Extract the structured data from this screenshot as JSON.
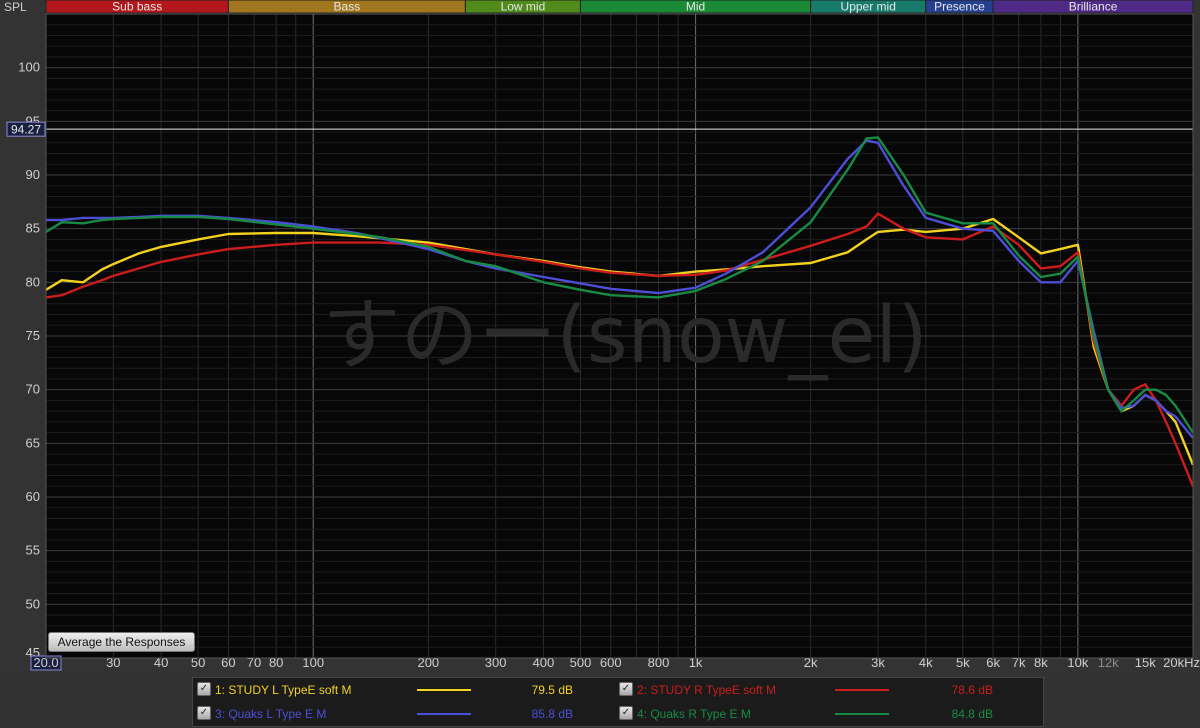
{
  "chart_data": {
    "type": "line",
    "ylabel": "SPL",
    "x_scale": "log",
    "xlim": [
      20,
      20000
    ],
    "ylim": [
      45,
      105
    ],
    "x_ticks": [
      {
        "v": 20,
        "label": "20.0",
        "box": true
      },
      {
        "v": 30,
        "label": "30"
      },
      {
        "v": 40,
        "label": "40"
      },
      {
        "v": 50,
        "label": "50"
      },
      {
        "v": 60,
        "label": "60"
      },
      {
        "v": 70,
        "label": "70"
      },
      {
        "v": 80,
        "label": "80"
      },
      {
        "v": 100,
        "label": "100"
      },
      {
        "v": 200,
        "label": "200"
      },
      {
        "v": 300,
        "label": "300"
      },
      {
        "v": 400,
        "label": "400"
      },
      {
        "v": 500,
        "label": "500"
      },
      {
        "v": 600,
        "label": "600"
      },
      {
        "v": 800,
        "label": "800"
      },
      {
        "v": 1000,
        "label": "1k"
      },
      {
        "v": 2000,
        "label": "2k"
      },
      {
        "v": 3000,
        "label": "3k"
      },
      {
        "v": 4000,
        "label": "4k"
      },
      {
        "v": 5000,
        "label": "5k"
      },
      {
        "v": 6000,
        "label": "6k"
      },
      {
        "v": 7000,
        "label": "7k"
      },
      {
        "v": 8000,
        "label": "8k"
      },
      {
        "v": 10000,
        "label": "10k"
      },
      {
        "v": 12000,
        "label": "12k",
        "dim": true
      },
      {
        "v": 15000,
        "label": "15k"
      },
      {
        "v": 20000,
        "label": "20kHz"
      }
    ],
    "y_ticks": [
      50,
      55,
      60,
      65,
      70,
      75,
      80,
      85,
      90,
      95,
      100
    ],
    "y_min_label": "45",
    "cursor": {
      "y": 94.27,
      "label": "94.27"
    },
    "bands": [
      {
        "name": "Sub bass",
        "from": 20,
        "to": 60,
        "color": "#b3161b"
      },
      {
        "name": "Bass",
        "from": 60,
        "to": 250,
        "color": "#a0771e"
      },
      {
        "name": "Low mid",
        "from": 250,
        "to": 500,
        "color": "#4f8a1a"
      },
      {
        "name": "Mid",
        "from": 500,
        "to": 2000,
        "color": "#1b8a37"
      },
      {
        "name": "Upper mid",
        "from": 2000,
        "to": 4000,
        "color": "#177a6a"
      },
      {
        "name": "Presence",
        "from": 4000,
        "to": 6000,
        "color": "#24408f"
      },
      {
        "name": "Brilliance",
        "from": 6000,
        "to": 20000,
        "color": "#4e2a86"
      }
    ],
    "watermark": "すのー(snow_el)",
    "series": [
      {
        "name": "1: STUDY L TypeE soft M",
        "color": "#f3d21f",
        "avg": "79.5 dB",
        "x": [
          20,
          22,
          25,
          28,
          30,
          35,
          40,
          50,
          60,
          80,
          100,
          130,
          150,
          200,
          250,
          300,
          400,
          500,
          600,
          800,
          1000,
          1200,
          1500,
          2000,
          2500,
          2800,
          3000,
          3500,
          4000,
          5000,
          6000,
          7000,
          8000,
          9000,
          10000,
          11000,
          12000,
          13000,
          14000,
          15000,
          16000,
          17000,
          18000,
          20000
        ],
        "y": [
          79.3,
          80.2,
          80.0,
          81.2,
          81.7,
          82.7,
          83.3,
          84.0,
          84.5,
          84.6,
          84.6,
          84.3,
          84.1,
          83.7,
          83.1,
          82.6,
          82.0,
          81.4,
          81.0,
          80.6,
          81.0,
          81.2,
          81.5,
          81.8,
          82.8,
          84.0,
          84.7,
          84.9,
          84.7,
          85.0,
          85.9,
          84.2,
          82.7,
          83.1,
          83.5,
          74.0,
          70.0,
          68.0,
          68.5,
          69.5,
          69.0,
          68.0,
          67.0,
          63.0
        ]
      },
      {
        "name": "2: STUDY R TypeE soft M",
        "color": "#cc1c1c",
        "avg": "78.6 dB",
        "x": [
          20,
          22,
          25,
          28,
          30,
          35,
          40,
          50,
          60,
          80,
          100,
          130,
          150,
          200,
          250,
          300,
          400,
          500,
          600,
          800,
          1000,
          1200,
          1500,
          2000,
          2500,
          2800,
          3000,
          3500,
          4000,
          5000,
          6000,
          7000,
          8000,
          9000,
          10000,
          11000,
          12000,
          13000,
          14000,
          15000,
          16000,
          17000,
          18000,
          20000
        ],
        "y": [
          78.6,
          78.8,
          79.6,
          80.2,
          80.6,
          81.3,
          81.9,
          82.6,
          83.1,
          83.5,
          83.7,
          83.7,
          83.7,
          83.5,
          83.0,
          82.6,
          81.9,
          81.3,
          80.9,
          80.6,
          80.7,
          81.1,
          82.1,
          83.4,
          84.5,
          85.2,
          86.4,
          85.0,
          84.2,
          84.0,
          85.2,
          83.5,
          81.3,
          81.5,
          82.8,
          74.5,
          70.0,
          68.5,
          70.0,
          70.5,
          69.0,
          67.0,
          65.0,
          61.0
        ]
      },
      {
        "name": "3: Quaks L Type E M",
        "color": "#4c4ed8",
        "avg": "85.8 dB",
        "x": [
          20,
          22,
          25,
          28,
          30,
          35,
          40,
          50,
          60,
          80,
          100,
          130,
          150,
          200,
          250,
          300,
          400,
          500,
          600,
          800,
          1000,
          1200,
          1500,
          2000,
          2500,
          2800,
          3000,
          3500,
          4000,
          5000,
          6000,
          7000,
          8000,
          9000,
          10000,
          11000,
          12000,
          13000,
          14000,
          15000,
          16000,
          17000,
          18000,
          20000
        ],
        "y": [
          85.8,
          85.8,
          86.0,
          86.0,
          86.0,
          86.1,
          86.2,
          86.2,
          86.0,
          85.6,
          85.2,
          84.6,
          84.1,
          83.1,
          82.0,
          81.3,
          80.5,
          79.9,
          79.4,
          79.0,
          79.5,
          80.8,
          82.8,
          87.0,
          91.5,
          93.2,
          93.0,
          89.0,
          86.0,
          85.0,
          84.8,
          82.0,
          80.0,
          80.0,
          82.0,
          75.5,
          70.0,
          68.3,
          68.5,
          69.5,
          69.0,
          68.0,
          67.5,
          65.5
        ]
      },
      {
        "name": "4: Quaks R Type E M",
        "color": "#178b45",
        "avg": "84.8 dB",
        "x": [
          20,
          22,
          25,
          28,
          30,
          35,
          40,
          50,
          60,
          80,
          100,
          130,
          150,
          200,
          250,
          300,
          400,
          500,
          600,
          800,
          1000,
          1200,
          1500,
          2000,
          2500,
          2800,
          3000,
          3500,
          4000,
          5000,
          6000,
          7000,
          8000,
          9000,
          10000,
          11000,
          12000,
          13000,
          14000,
          15000,
          16000,
          17000,
          18000,
          20000
        ],
        "y": [
          84.7,
          85.6,
          85.5,
          85.8,
          85.9,
          86.0,
          86.1,
          86.1,
          85.9,
          85.4,
          85.0,
          84.5,
          84.2,
          83.3,
          82.0,
          81.5,
          80.0,
          79.3,
          78.8,
          78.6,
          79.2,
          80.3,
          82.0,
          85.6,
          90.5,
          93.4,
          93.5,
          90.0,
          86.5,
          85.5,
          85.5,
          82.5,
          80.5,
          80.8,
          82.4,
          75.0,
          70.0,
          68.0,
          69.0,
          70.0,
          70.0,
          69.5,
          68.5,
          66.0
        ]
      }
    ]
  },
  "ui": {
    "average_button": "Average the Responses"
  },
  "legend": [
    {
      "check": "✓",
      "name": "1: STUDY L TypeE soft M",
      "color": "#f3d21f",
      "avg": "79.5 dB"
    },
    {
      "check": "✓",
      "name": "2: STUDY R TypeE soft M",
      "color": "#cc1c1c",
      "avg": "78.6 dB"
    },
    {
      "check": "✓",
      "name": "3: Quaks L Type E M",
      "color": "#4c4ed8",
      "avg": "85.8 dB"
    },
    {
      "check": "✓",
      "name": "4: Quaks R Type E M",
      "color": "#178b45",
      "avg": "84.8 dB"
    }
  ]
}
